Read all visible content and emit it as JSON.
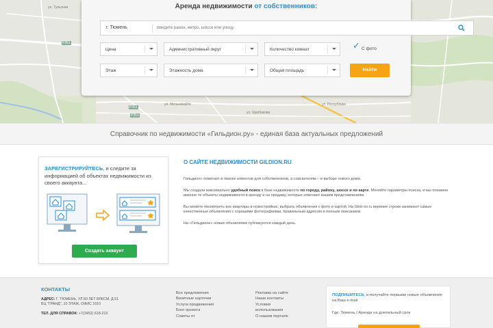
{
  "map": {
    "labels": [
      "ул. Тульская",
      "Р351",
      "Р351",
      "Р351",
      "ул. Мельникайте",
      "ул. Щербакова",
      "ул. Республики"
    ]
  },
  "search": {
    "title_main": "Аренда недвижимости",
    "title_accent": "от собственников:",
    "city": "г. Тюмень",
    "location_placeholder": "Введите район, метро, шоссе или улицу",
    "filters": {
      "price": "Цена",
      "district": "Административный округ",
      "rooms": "Количество комнат",
      "floor": "Этаж",
      "floors_in_house": "Этажность дома",
      "total_area": "Общая площадь"
    },
    "with_photo_label": "С фото",
    "with_photo_checked": true,
    "find_button": "Найти"
  },
  "tagline": "Справочник по недвижимости «Гильдион.ру» - единая база актуальных предложений",
  "register": {
    "highlight": "ЗАРЕГИСТРИРУЙТЕСЬ",
    "text": ", и следите за информацией об объектах недвижимости из своего аккаунта...",
    "button": "Создать аккаунт"
  },
  "about": {
    "title": "О САЙТЕ НЕДВИЖИМОСТИ GILDION.RU",
    "p1": "Гильдион» помогает в поиске клиентов для собственников, а соискателям – в выборе нового дома.",
    "p2_a": "Мы создали максимально ",
    "p2_b": "удобный поиск",
    "p2_c": " в базе недвижимости ",
    "p2_d": "по городу, району, шоссе и по карте",
    "p2_e": ". Меняйте параметры поиска, и мы покажем именно те объекты недвижимости в аренду и на продажу, которые отвечают вашим представлениям.",
    "p3": "Вы можете посмотреть все квартиры в новостройках, выбрать объявления с фото и картой. На Gildi-on.ru верхние строки занимают самые качественные объявления с хорошими фотографиями, правильным адресом и полным описанием.",
    "p4": "На «Гильдионе» новые объявления публикуются каждый день."
  },
  "footer": {
    "contacts_title": "КОНТАКТЫ",
    "address_label": "АДРЕС:",
    "address_line1": " Г. ТЮМЕНЬ, УЛ.50 ЛЕТ ВЛКСМ, Д.51",
    "address_line2": "БЦ \"ГРАНД\", 10 ЭТАЖ, ОФИС 1010",
    "phone_label": "ТЕЛ. ДЛЯ СПРАВОК:",
    "phone": " +7(3452) 618-219",
    "col1": [
      "Все предложения",
      "Визитные карточки",
      "Услуги продвижения",
      "Блог проекта",
      "Советы от"
    ],
    "col2": [
      "Реклама на сайте",
      "Наши контакты",
      "Условия",
      "использования",
      "О нашем портале"
    ],
    "subscribe_highlight": "ПОДПИШИТЕСЬ",
    "subscribe_text": ", и получайте первыми новые объявления на Ваш e-mail.",
    "subscribe_query": "Где: Тюмень / Аренда на длительный срок"
  },
  "colors": {
    "accent": "#2a8fd0",
    "orange": "#f6a416",
    "green": "#2dab4e"
  }
}
